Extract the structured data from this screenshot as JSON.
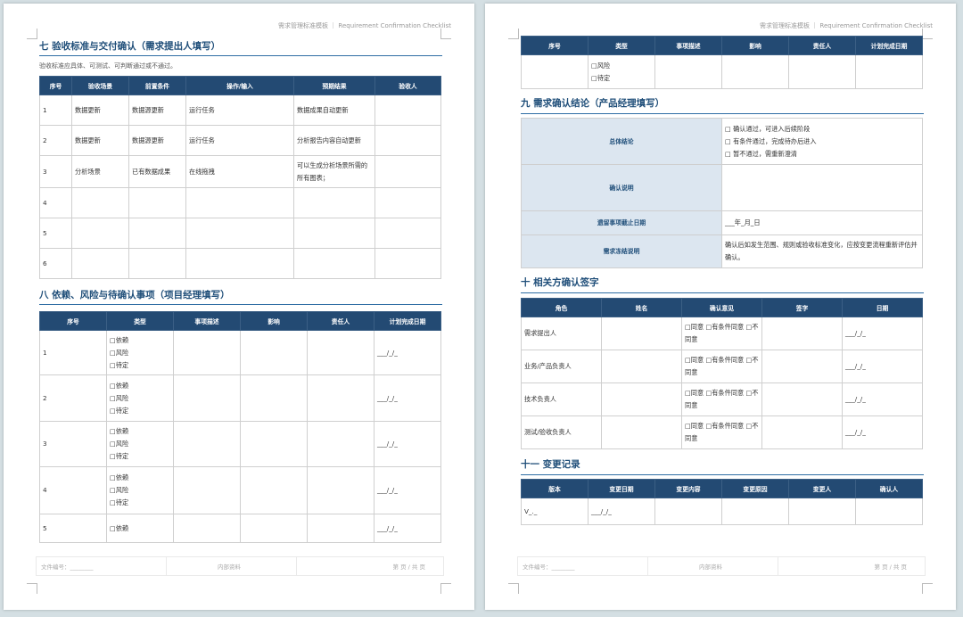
{
  "header_text": "需求管理标准模板 ｜ Requirement Confirmation Checklist",
  "footer": {
    "doc_no": "文件编号：________",
    "internal": "内部资料",
    "page": "第 页 / 共 页"
  },
  "page1": {
    "sec7": {
      "title": "七  验收标准与交付确认（需求提出人填写）",
      "note": "验收标准应具体、可测试、可判断通过或不通过。",
      "headers": [
        "序号",
        "验收场景",
        "前置条件",
        "操作/输入",
        "预期结果",
        "验收人"
      ],
      "rows": [
        [
          "1",
          "数据更新",
          "数据源更新",
          "运行任务",
          "数据成果自动更新",
          ""
        ],
        [
          "2",
          "数据更新",
          "数据源更新",
          "运行任务",
          "分析报告内容自动更新",
          ""
        ],
        [
          "3",
          "分析场景",
          "已有数据成果",
          "在线拖拽",
          "可以生成分析场景所需的所有图表；",
          ""
        ],
        [
          "4",
          "",
          "",
          "",
          "",
          ""
        ],
        [
          "5",
          "",
          "",
          "",
          "",
          ""
        ],
        [
          "6",
          "",
          "",
          "",
          "",
          ""
        ]
      ]
    },
    "sec8": {
      "title": "八  依赖、风险与待确认事项（项目经理填写）",
      "headers": [
        "序号",
        "类型",
        "事项描述",
        "影响",
        "责任人",
        "计划完成日期"
      ],
      "rows": [
        {
          "no": "1",
          "types": [
            "□依赖",
            "□风险",
            "□待定"
          ],
          "date": "___/_/_"
        },
        {
          "no": "2",
          "types": [
            "□依赖",
            "□风险",
            "□待定"
          ],
          "date": "___/_/_"
        },
        {
          "no": "3",
          "types": [
            "□依赖",
            "□风险",
            "□待定"
          ],
          "date": "___/_/_"
        },
        {
          "no": "4",
          "types": [
            "□依赖",
            "□风险",
            "□待定"
          ],
          "date": "___/_/_"
        },
        {
          "no": "5",
          "types": [
            "□依赖"
          ],
          "date": "___/_/_"
        }
      ]
    }
  },
  "page2": {
    "cont": {
      "headers": [
        "序号",
        "类型",
        "事项描述",
        "影响",
        "责任人",
        "计划完成日期"
      ],
      "types": [
        "□风险",
        "□待定"
      ]
    },
    "sec9": {
      "title": "九  需求确认结论（产品经理填写）",
      "rows": [
        {
          "label": "总体结论",
          "lines": [
            "□ 确认通过，可进入后续阶段",
            "□ 有条件通过，完成待办后进入",
            "□ 暂不通过，需重新澄清"
          ]
        },
        {
          "label": "确认说明",
          "lines": []
        },
        {
          "label": "遗留事项截止日期",
          "lines": [
            "___年_月_日"
          ]
        },
        {
          "label": "需求冻结说明",
          "lines": [
            "确认后如发生范围、规则或验收标准变化，应按变更流程重新评估并确认。"
          ]
        }
      ]
    },
    "sec10": {
      "title": "十  相关方确认签字",
      "headers": [
        "角色",
        "姓名",
        "确认意见",
        "签字",
        "日期"
      ],
      "rows": [
        {
          "role": "需求提出人",
          "opinion": "□同意 □有条件同意 □不同意",
          "date": "___/_/_"
        },
        {
          "role": "业务/产品负责人",
          "opinion": "□同意 □有条件同意 □不同意",
          "date": "___/_/_"
        },
        {
          "role": "技术负责人",
          "opinion": "□同意 □有条件同意 □不同意",
          "date": "___/_/_"
        },
        {
          "role": "测试/验收负责人",
          "opinion": "□同意 □有条件同意 □不同意",
          "date": "___/_/_"
        }
      ]
    },
    "sec11": {
      "title": "十一  变更记录",
      "headers": [
        "版本",
        "变更日期",
        "变更内容",
        "变更原因",
        "变更人",
        "确认人"
      ],
      "row": [
        "V_._",
        "___/_/_",
        "",
        "",
        "",
        ""
      ]
    }
  }
}
